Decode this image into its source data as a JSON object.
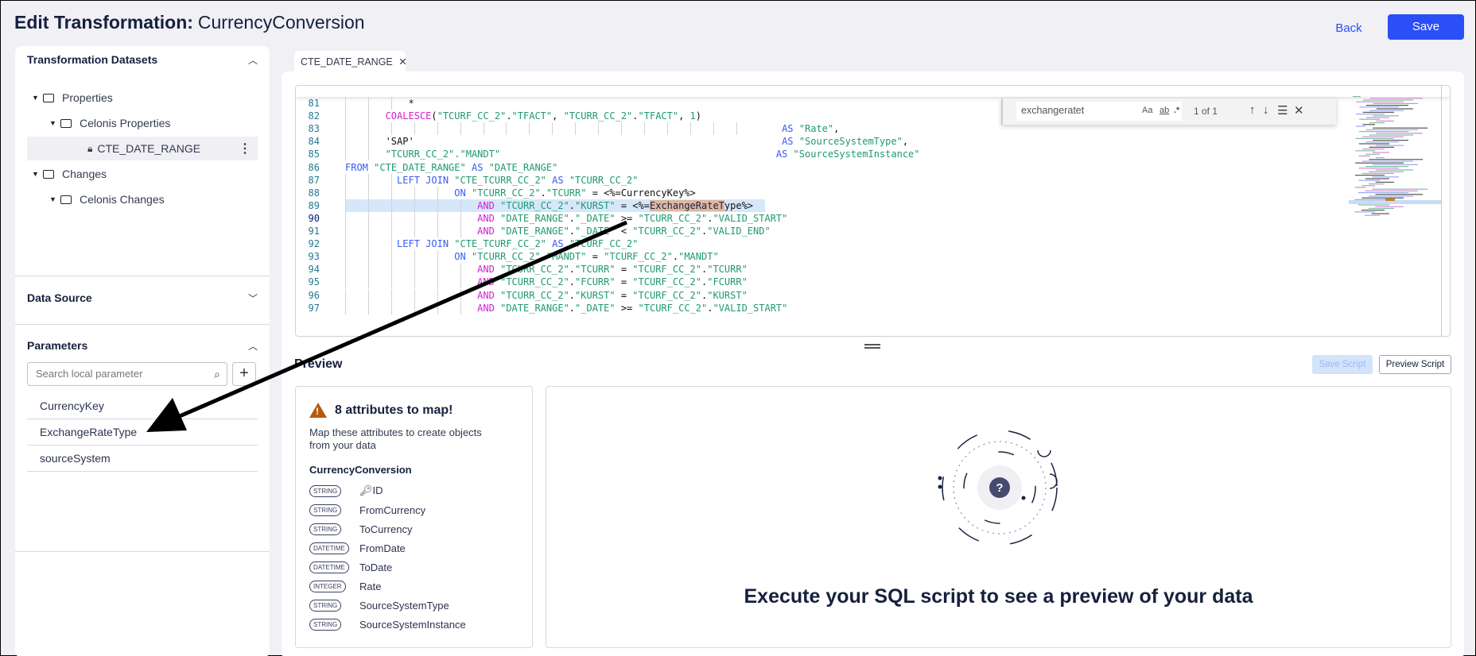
{
  "header": {
    "title_bold": "Edit Transformation:",
    "title_name": "CurrencyConversion",
    "back_label": "Back",
    "save_label": "Save"
  },
  "sidebar": {
    "datasets_title": "Transformation Datasets",
    "tree": [
      {
        "label": "Properties",
        "level": 0,
        "type": "folder"
      },
      {
        "label": "Celonis Properties",
        "level": 1,
        "type": "folder"
      },
      {
        "label": "CTE_DATE_RANGE",
        "level": 2,
        "type": "locked",
        "selected": true
      },
      {
        "label": "Changes",
        "level": 0,
        "type": "folder"
      },
      {
        "label": "Celonis Changes",
        "level": 1,
        "type": "folder"
      }
    ],
    "data_source_title": "Data Source",
    "parameters_title": "Parameters",
    "search_placeholder": "Search local parameter",
    "parameters": [
      "CurrencyKey",
      "ExchangeRateType",
      "sourceSystem"
    ]
  },
  "editor": {
    "tab_label": "CTE_DATE_RANGE",
    "current_line": 90,
    "highlight_line": 89,
    "find": {
      "value": "exchangeratet",
      "match_case": "Aa",
      "whole_word": "ab",
      "regex": ".*",
      "count": "1 of 1"
    },
    "lines": [
      {
        "n": 81,
        "t": [
          [
            "pl",
            "           *"
          ]
        ]
      },
      {
        "n": 82,
        "t": [
          [
            "pl",
            "       "
          ],
          [
            "fn",
            "COALESCE"
          ],
          [
            "pl",
            "("
          ],
          [
            "str",
            "\"TCURF_CC_2\""
          ],
          [
            "pl",
            "."
          ],
          [
            "str",
            "\"TFACT\""
          ],
          [
            "pl",
            ", "
          ],
          [
            "str",
            "\"TCURR_CC_2\""
          ],
          [
            "pl",
            "."
          ],
          [
            "str",
            "\"TFACT\""
          ],
          [
            "pl",
            ", "
          ],
          [
            "num",
            "1"
          ],
          [
            "pl",
            ")"
          ]
        ]
      },
      {
        "n": 83,
        "t": [
          [
            "pl",
            "                                                                            "
          ],
          [
            "kw",
            "AS"
          ],
          [
            "pl",
            " "
          ],
          [
            "str",
            "\"Rate\""
          ],
          [
            "pl",
            ","
          ]
        ]
      },
      {
        "n": 84,
        "t": [
          [
            "pl",
            "       "
          ],
          [
            "pl",
            "'SAP'"
          ],
          [
            "pl",
            "                                                                "
          ],
          [
            "kw",
            "AS"
          ],
          [
            "pl",
            " "
          ],
          [
            "str",
            "\"SourceSystemType\""
          ],
          [
            "pl",
            ","
          ]
        ]
      },
      {
        "n": 85,
        "t": [
          [
            "pl",
            "       "
          ],
          [
            "str",
            "\"TCURR_CC_2\".\"MANDT\""
          ],
          [
            "pl",
            "                                                "
          ],
          [
            "kw",
            "AS"
          ],
          [
            "pl",
            " "
          ],
          [
            "str",
            "\"SourceSystemInstance\""
          ]
        ]
      },
      {
        "n": 86,
        "t": [
          [
            "kw",
            "FROM"
          ],
          [
            "pl",
            " "
          ],
          [
            "str",
            "\"CTE_DATE_RANGE\""
          ],
          [
            "pl",
            " "
          ],
          [
            "kw",
            "AS"
          ],
          [
            "pl",
            " "
          ],
          [
            "str",
            "\"DATE_RANGE\""
          ]
        ]
      },
      {
        "n": 87,
        "t": [
          [
            "pl",
            "         "
          ],
          [
            "kw",
            "LEFT JOIN"
          ],
          [
            "pl",
            " "
          ],
          [
            "str",
            "\"CTE_TCURR_CC_2\""
          ],
          [
            "pl",
            " "
          ],
          [
            "kw",
            "AS"
          ],
          [
            "pl",
            " "
          ],
          [
            "str",
            "\"TCURR_CC_2\""
          ]
        ]
      },
      {
        "n": 88,
        "t": [
          [
            "pl",
            "                   "
          ],
          [
            "kw",
            "ON"
          ],
          [
            "pl",
            " "
          ],
          [
            "str",
            "\"TCURR_CC_2\""
          ],
          [
            "pl",
            "."
          ],
          [
            "str",
            "\"TCURR\""
          ],
          [
            "pl",
            " = <%=CurrencyKey%>"
          ]
        ]
      },
      {
        "n": 89,
        "t": [
          [
            "pl",
            "                       "
          ],
          [
            "fn",
            "AND"
          ],
          [
            "pl",
            " "
          ],
          [
            "str",
            "\"TCURR_CC_2\""
          ],
          [
            "pl",
            "."
          ],
          [
            "str",
            "\"KURST\""
          ],
          [
            "pl",
            " = <%="
          ],
          [
            "match",
            "ExchangeRateT"
          ],
          [
            "pl",
            "ype%>"
          ]
        ]
      },
      {
        "n": 90,
        "t": [
          [
            "pl",
            "                       "
          ],
          [
            "fn",
            "AND"
          ],
          [
            "pl",
            " "
          ],
          [
            "str",
            "\"DATE_RANGE\""
          ],
          [
            "pl",
            "."
          ],
          [
            "str",
            "\"_DATE\""
          ],
          [
            "pl",
            " >= "
          ],
          [
            "str",
            "\"TCURR_CC_2\""
          ],
          [
            "pl",
            "."
          ],
          [
            "str",
            "\"VALID_START\""
          ]
        ]
      },
      {
        "n": 91,
        "t": [
          [
            "pl",
            "                       "
          ],
          [
            "fn",
            "AND"
          ],
          [
            "pl",
            " "
          ],
          [
            "str",
            "\"DATE_RANGE\""
          ],
          [
            "pl",
            "."
          ],
          [
            "str",
            "\"_DATE\""
          ],
          [
            "pl",
            " < "
          ],
          [
            "str",
            "\"TCURR_CC_2\""
          ],
          [
            "pl",
            "."
          ],
          [
            "str",
            "\"VALID_END\""
          ]
        ]
      },
      {
        "n": 92,
        "t": [
          [
            "pl",
            "         "
          ],
          [
            "kw",
            "LEFT JOIN"
          ],
          [
            "pl",
            " "
          ],
          [
            "str",
            "\"CTE_TCURF_CC_2\""
          ],
          [
            "pl",
            " "
          ],
          [
            "kw",
            "AS"
          ],
          [
            "pl",
            " "
          ],
          [
            "str",
            "\"TCURF_CC_2\""
          ]
        ]
      },
      {
        "n": 93,
        "t": [
          [
            "pl",
            "                   "
          ],
          [
            "kw",
            "ON"
          ],
          [
            "pl",
            " "
          ],
          [
            "str",
            "\"TCURR_CC_2\""
          ],
          [
            "pl",
            "."
          ],
          [
            "str",
            "\"MANDT\""
          ],
          [
            "pl",
            " = "
          ],
          [
            "str",
            "\"TCURF_CC_2\""
          ],
          [
            "pl",
            "."
          ],
          [
            "str",
            "\"MANDT\""
          ]
        ]
      },
      {
        "n": 94,
        "t": [
          [
            "pl",
            "                       "
          ],
          [
            "fn",
            "AND"
          ],
          [
            "pl",
            " "
          ],
          [
            "str",
            "\"TCURR_CC_2\""
          ],
          [
            "pl",
            "."
          ],
          [
            "str",
            "\"TCURR\""
          ],
          [
            "pl",
            " = "
          ],
          [
            "str",
            "\"TCURF_CC_2\""
          ],
          [
            "pl",
            "."
          ],
          [
            "str",
            "\"TCURR\""
          ]
        ]
      },
      {
        "n": 95,
        "t": [
          [
            "pl",
            "                       "
          ],
          [
            "fn",
            "AND"
          ],
          [
            "pl",
            " "
          ],
          [
            "str",
            "\"TCURR_CC_2\""
          ],
          [
            "pl",
            "."
          ],
          [
            "str",
            "\"FCURR\""
          ],
          [
            "pl",
            " = "
          ],
          [
            "str",
            "\"TCURF_CC_2\""
          ],
          [
            "pl",
            "."
          ],
          [
            "str",
            "\"FCURR\""
          ]
        ]
      },
      {
        "n": 96,
        "t": [
          [
            "pl",
            "                       "
          ],
          [
            "fn",
            "AND"
          ],
          [
            "pl",
            " "
          ],
          [
            "str",
            "\"TCURR_CC_2\""
          ],
          [
            "pl",
            "."
          ],
          [
            "str",
            "\"KURST\""
          ],
          [
            "pl",
            " = "
          ],
          [
            "str",
            "\"TCURF_CC_2\""
          ],
          [
            "pl",
            "."
          ],
          [
            "str",
            "\"KURST\""
          ]
        ]
      },
      {
        "n": 97,
        "t": [
          [
            "pl",
            "                       "
          ],
          [
            "fn",
            "AND"
          ],
          [
            "pl",
            " "
          ],
          [
            "str",
            "\"DATE_RANGE\""
          ],
          [
            "pl",
            "."
          ],
          [
            "str",
            "\"_DATE\""
          ],
          [
            "pl",
            " >= "
          ],
          [
            "str",
            "\"TCURF_CC_2\""
          ],
          [
            "pl",
            "."
          ],
          [
            "str",
            "\"VALID_START\""
          ]
        ]
      }
    ]
  },
  "preview": {
    "title": "Preview",
    "save_script_label": "Save Script",
    "preview_script_label": "Preview Script",
    "attributes": {
      "heading": "8 attributes to map!",
      "warning_icon": "!",
      "description": "Map these attributes to create objects from your data",
      "entity": "CurrencyConversion",
      "items": [
        {
          "type": "STRING",
          "name": "ID",
          "key": true
        },
        {
          "type": "STRING",
          "name": "FromCurrency"
        },
        {
          "type": "STRING",
          "name": "ToCurrency"
        },
        {
          "type": "DATETIME",
          "name": "FromDate"
        },
        {
          "type": "DATETIME",
          "name": "ToDate"
        },
        {
          "type": "INTEGER",
          "name": "Rate"
        },
        {
          "type": "STRING",
          "name": "SourceSystemType"
        },
        {
          "type": "STRING",
          "name": "SourceSystemInstance"
        }
      ]
    },
    "empty_message": "Execute your SQL script to see a preview of your data",
    "empty_icon": "?"
  },
  "colors": {
    "accent": "#2a4ff6",
    "keyword": "#3b5bf0",
    "string": "#1f9a6e",
    "function": "#d21fd2",
    "warning": "#b55a0d"
  }
}
